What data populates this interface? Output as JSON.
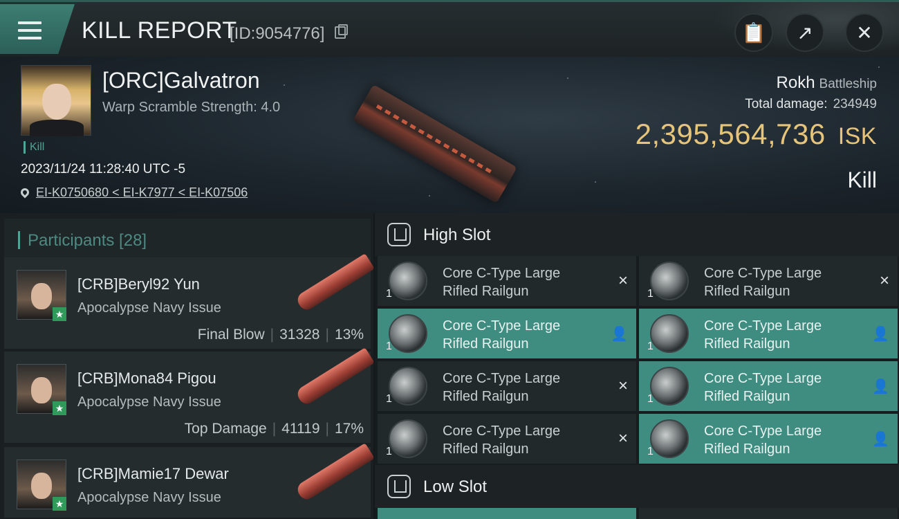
{
  "header": {
    "title": "KILL REPORT",
    "report_id": "[ID:9054776]"
  },
  "victim": {
    "name": "[ORC]Galvatron",
    "warp_scramble": "Warp Scramble Strength: 4.0",
    "kill_tag": "Kill",
    "datetime": "2023/11/24 11:28:40 UTC -5",
    "location": "EI-K0750680 < EI-K7977 < EI-K07506",
    "ship_name": "Rokh",
    "ship_class": "Battleship",
    "total_damage_label": "Total damage:",
    "total_damage": "234949",
    "isk_value": "2,395,564,736",
    "isk_unit": "ISK",
    "result": "Kill"
  },
  "participants": {
    "title": "Participants [28]",
    "items": [
      {
        "name": "[CRB]Beryl92 Yun",
        "ship": "Apocalypse Navy Issue",
        "tag": "Final Blow",
        "damage": "31328",
        "percent": "13%"
      },
      {
        "name": "[CRB]Mona84 Pigou",
        "ship": "Apocalypse Navy Issue",
        "tag": "Top Damage",
        "damage": "41119",
        "percent": "17%"
      },
      {
        "name": "[CRB]Mamie17 Dewar",
        "ship": "Apocalypse Navy Issue",
        "tag": "",
        "damage": "",
        "percent": ""
      }
    ]
  },
  "slots": {
    "high_slot_title": "High Slot",
    "low_slot_title": "Low Slot",
    "modules": [
      {
        "qty": "1",
        "line1": "Core C-Type Large",
        "line2": "Rifled Railgun",
        "status": "×"
      },
      {
        "qty": "1",
        "line1": "Core C-Type Large",
        "line2": "Rifled Railgun",
        "status": "×"
      },
      {
        "qty": "1",
        "line1": "Core C-Type Large",
        "line2": "Rifled Railgun",
        "status": "👤"
      },
      {
        "qty": "1",
        "line1": "Core C-Type Large",
        "line2": "Rifled Railgun",
        "status": "👤"
      },
      {
        "qty": "1",
        "line1": "Core C-Type Large",
        "line2": "Rifled Railgun",
        "status": "×"
      },
      {
        "qty": "1",
        "line1": "Core C-Type Large",
        "line2": "Rifled Railgun",
        "status": "👤"
      },
      {
        "qty": "1",
        "line1": "Core C-Type Large",
        "line2": "Rifled Railgun",
        "status": "×"
      },
      {
        "qty": "1",
        "line1": "Core C-Type Large",
        "line2": "Rifled Railgun",
        "status": "👤"
      }
    ]
  },
  "colors": {
    "accent": "#3f8c80",
    "isk": "#e6c47a",
    "final_blow_star": "#2f9a5a"
  }
}
